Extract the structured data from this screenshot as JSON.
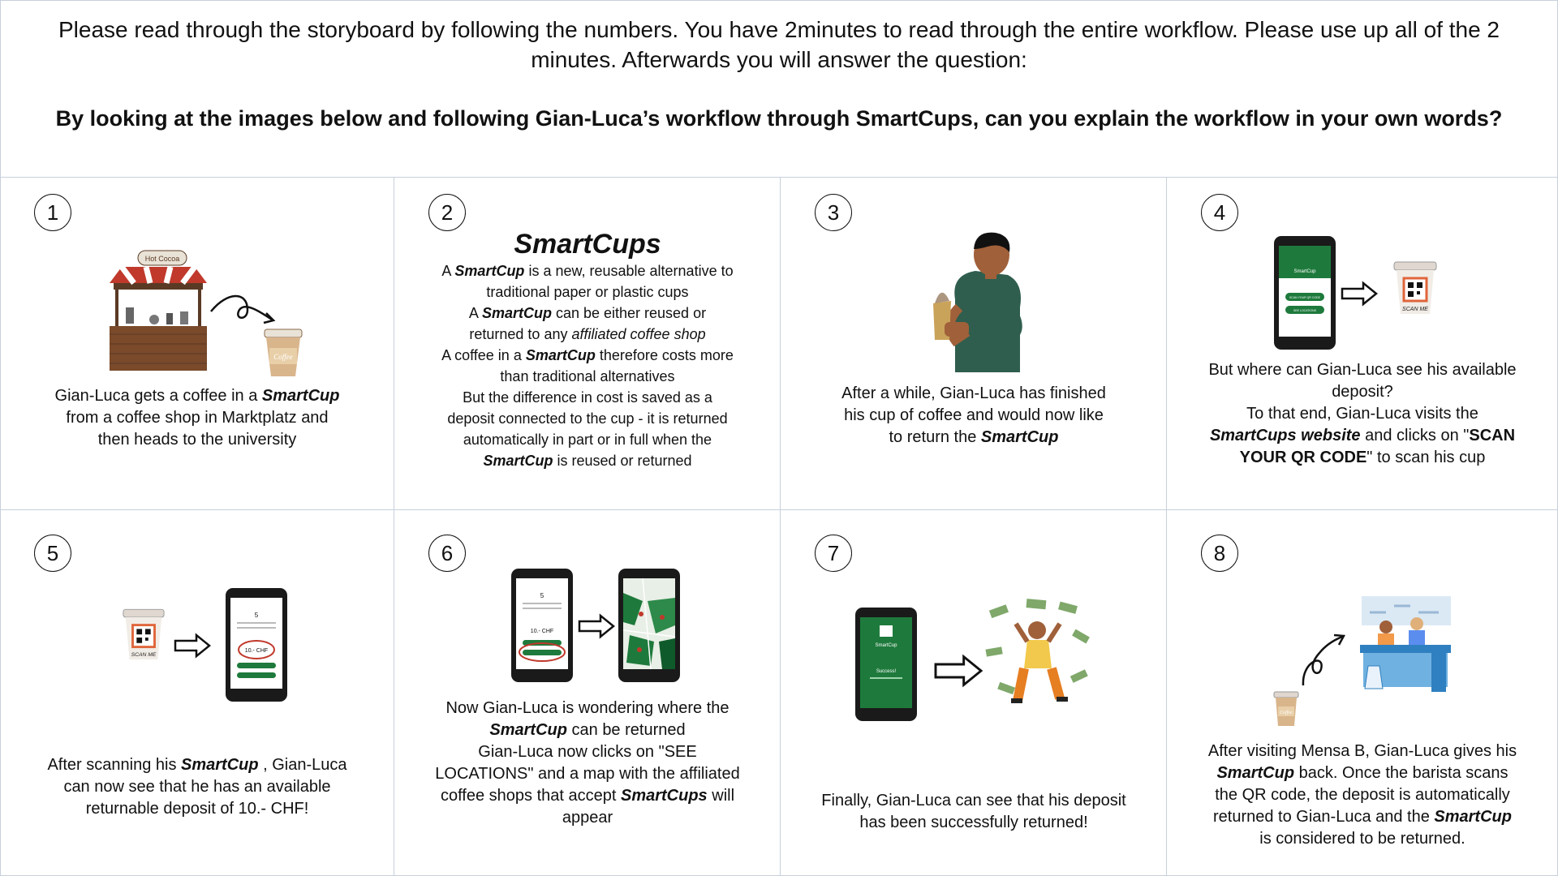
{
  "header": {
    "intro": "Please read through the storyboard by following the numbers. You have 2minutes to read through the entire workflow. Please use up all of the 2 minutes. Afterwards you will answer the question:",
    "question": "By looking at the images below and following Gian-Luca’s workflow through SmartCups, can you explain the workflow in your own words?"
  },
  "panels": {
    "p1": {
      "num": "1",
      "sign": "Hot Cocoa",
      "cup_label": "Coffee",
      "line1_pre": "Gian-Luca gets a coffee in a ",
      "line1_brand": "SmartCup",
      "line2": "from a coffee shop in Marktplatz and",
      "line3": "then heads to the university"
    },
    "p2": {
      "num": "2",
      "title": "SmartCups",
      "l1_pre": "A ",
      "l1_brand": "SmartCup",
      "l1_post": " is a new, reusable alternative to",
      "l2": "traditional paper or plastic cups",
      "l3_pre": "A ",
      "l3_brand": "SmartCup",
      "l3_post": " can be either reused or",
      "l4_pre": "returned to any ",
      "l4_it": "affiliated coffee shop",
      "l5_pre": "A coffee in a ",
      "l5_brand": "SmartCup",
      "l5_post": " therefore costs more",
      "l6": "than traditional alternatives",
      "l7": "But the difference in cost is saved as a",
      "l8": "deposit connected to the cup - it is returned",
      "l9": "automatically in part or in full when the",
      "l10_brand": "SmartCup",
      "l10_post": " is reused or returned"
    },
    "p3": {
      "num": "3",
      "l1": "After a while, Gian-Luca has finished",
      "l2": "his cup of coffee and would now like",
      "l3_pre": "to return the ",
      "l3_brand": "SmartCup"
    },
    "p4": {
      "num": "4",
      "phone_brand": "SmartCup",
      "phone_btn1": "SCAN YOUR QR CODE",
      "phone_btn2": "SEE LOCATIONS",
      "scan_label": "SCAN ME",
      "l1": "But where can Gian-Luca see his available",
      "l2": "deposit?",
      "l3": "To that end, Gian-Luca visits the",
      "l4_brand": "SmartCups website",
      "l4_post": " and clicks on \"",
      "l4_bold": "SCAN",
      "l5_bold": "YOUR QR CODE",
      "l5_post": "\" to scan his cup"
    },
    "p5": {
      "num": "5",
      "scan_label": "SCAN ME",
      "phone_count": "5",
      "phone_deposit": "10.- CHF",
      "l1_pre": "After scanning his ",
      "l1_brand": "SmartCup",
      "l1_post": " , Gian-Luca",
      "l2": "can now see that he has an available",
      "l3": "returnable deposit of 10.- CHF!"
    },
    "p6": {
      "num": "6",
      "phone_count": "5",
      "phone_deposit": "10.- CHF",
      "l1": "Now Gian-Luca is wondering where the",
      "l2_brand": "SmartCup",
      "l2_post": " can be returned",
      "l3": "Gian-Luca now clicks on \"SEE",
      "l4": "LOCATIONS\" and a map with the affiliated",
      "l5_pre": "coffee shops that accept ",
      "l5_brand": "SmartCups",
      "l5_post": " will",
      "l6": "appear"
    },
    "p7": {
      "num": "7",
      "phone_brand": "SmartCup",
      "phone_status": "Success!",
      "l1": "Finally, Gian-Luca can see that his deposit",
      "l2": "has been successfully returned!"
    },
    "p8": {
      "num": "8",
      "cup_label": "Coffee",
      "l1": "After visiting Mensa B, Gian-Luca gives his",
      "l2_brand": "SmartCup",
      "l2_post": " back. Once the barista scans",
      "l3": "the QR code, the deposit is automatically",
      "l4_pre": "returned to Gian-Luca and the ",
      "l4_brand": "SmartCup",
      "l5": "is considered to be returned."
    }
  },
  "colors": {
    "green": "#1e7a3c",
    "dark_green": "#0f5a2a",
    "border": "#c7d0dc",
    "cup": "#c9a27a"
  }
}
